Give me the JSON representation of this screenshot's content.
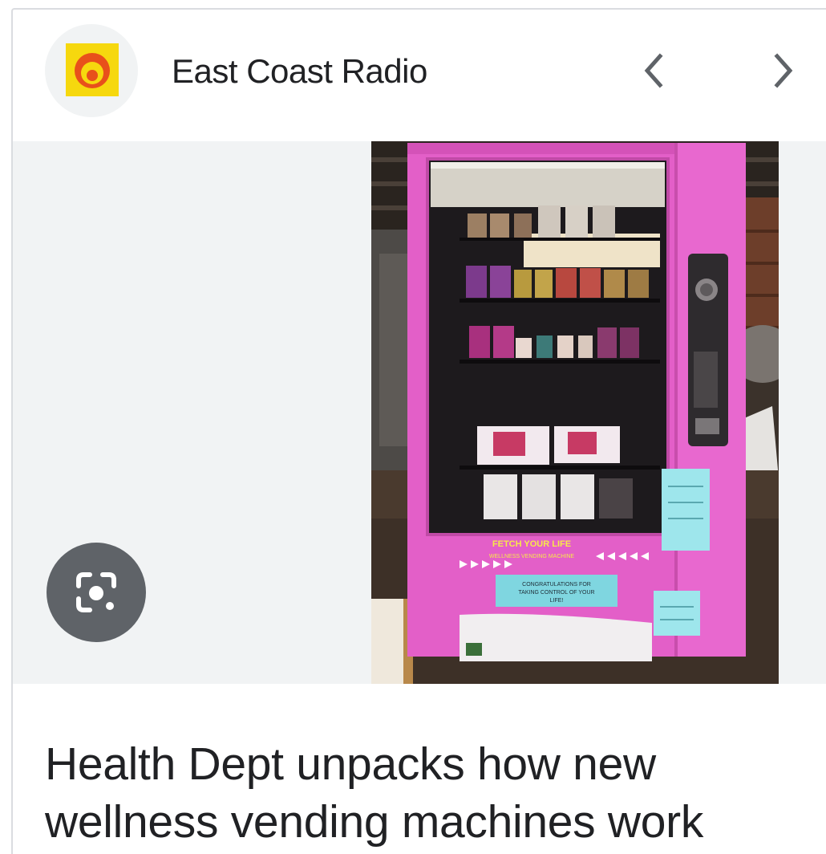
{
  "source": {
    "name": "East Coast Radio",
    "logo_icon": "east-coast-radio-logo",
    "logo_colors": {
      "tile": "#f6d80e",
      "ring": "#e8501b"
    }
  },
  "navigation": {
    "prev_icon": "chevron-left-icon",
    "next_icon": "chevron-right-icon"
  },
  "image": {
    "subject": "pink-wellness-vending-machine",
    "machine_banner_line1": "FETCH YOUR LIFE",
    "machine_banner_line2": "WELLNESS VENDING MACHINE",
    "machine_screen_line1": "CONGRATULATIONS FOR",
    "machine_screen_line2": "TAKING CONTROL OF YOUR",
    "machine_screen_line3": "LIFE!"
  },
  "lens": {
    "icon": "google-lens-icon"
  },
  "article": {
    "headline": "Health Dept unpacks how new wellness vending machines work"
  },
  "colors": {
    "background": "#ffffff",
    "image_backdrop": "#f1f3f4",
    "machine_pink": "#e35fc8",
    "lens_button": "#5f6368",
    "text_primary": "#202124",
    "icon_gray": "#5f6368"
  }
}
